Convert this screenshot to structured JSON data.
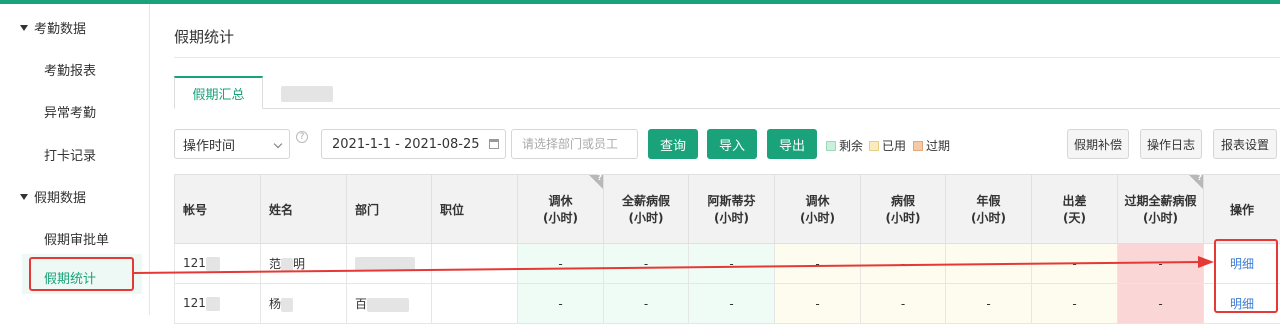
{
  "sidebar": {
    "groups": [
      {
        "label": "考勤数据",
        "items": [
          "考勤报表",
          "异常考勤",
          "打卡记录"
        ]
      },
      {
        "label": "假期数据",
        "items": [
          "假期审批单",
          "假期统计"
        ]
      }
    ],
    "active_item": "假期统计"
  },
  "page": {
    "title": "假期统计"
  },
  "tabs": [
    {
      "label": "假期汇总"
    }
  ],
  "filters": {
    "time_type": "操作时间",
    "date_range": "2021-1-1 - 2021-08-25",
    "search_placeholder": "请选择部门或员工"
  },
  "toolbar": {
    "query": "查询",
    "import": "导入",
    "export": "导出",
    "legend": [
      {
        "label": "剩余",
        "color": "#c8f0dc"
      },
      {
        "label": "已用",
        "color": "#fbecc0"
      },
      {
        "label": "过期",
        "color": "#f6c9a8"
      }
    ],
    "compensate": "假期补偿",
    "log": "操作日志",
    "settings": "报表设置"
  },
  "table": {
    "columns": [
      {
        "l1": "帐号",
        "l2": ""
      },
      {
        "l1": "姓名",
        "l2": ""
      },
      {
        "l1": "部门",
        "l2": ""
      },
      {
        "l1": "职位",
        "l2": ""
      },
      {
        "l1": "调休",
        "l2": "(小时)"
      },
      {
        "l1": "全薪病假",
        "l2": "(小时)"
      },
      {
        "l1": "阿斯蒂芬",
        "l2": "(小时)"
      },
      {
        "l1": "调休",
        "l2": "(小时)"
      },
      {
        "l1": "病假",
        "l2": "(小时)"
      },
      {
        "l1": "年假",
        "l2": "(小时)"
      },
      {
        "l1": "出差",
        "l2": "(天)"
      },
      {
        "l1": "过期全薪病假",
        "l2": "(小时)"
      },
      {
        "l1": "操作",
        "l2": ""
      }
    ],
    "rows": [
      {
        "account": "121",
        "name": "范",
        "name_tail": "明",
        "dept": "",
        "position": "",
        "values": [
          "-",
          "-",
          "-",
          "-",
          "-",
          "-",
          "-",
          "-"
        ],
        "action": "明细"
      },
      {
        "account": "121",
        "name": "杨",
        "name_tail": "",
        "dept": "百",
        "position": "",
        "values": [
          "-",
          "-",
          "-",
          "-",
          "-",
          "-",
          "-",
          "-"
        ],
        "action": "明细"
      }
    ]
  }
}
